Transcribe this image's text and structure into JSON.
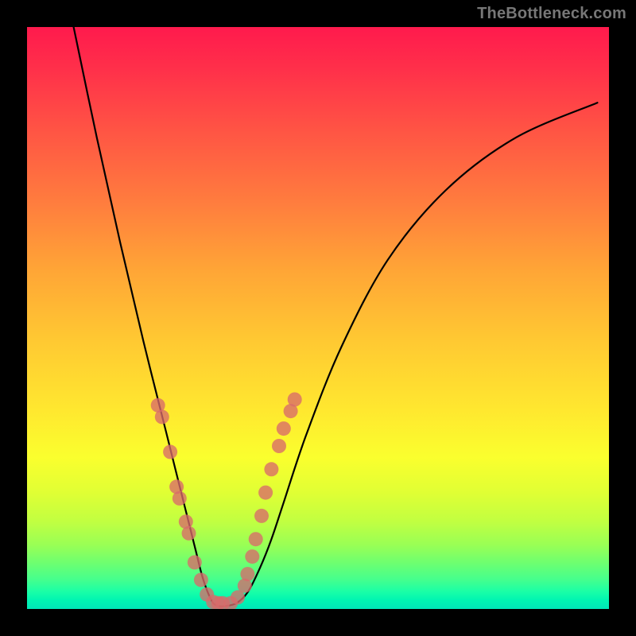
{
  "watermark_text": "TheBottleneck.com",
  "chart_data": {
    "type": "line",
    "title": "",
    "xlabel": "",
    "ylabel": "",
    "xlim": [
      0,
      100
    ],
    "ylim": [
      0,
      100
    ],
    "grid": false,
    "legend": false,
    "annotations": [
      "TheBottleneck.com"
    ],
    "background_gradient": {
      "direction": "vertical",
      "stops": [
        {
          "pos": 0.0,
          "color": "#ff1a4d"
        },
        {
          "pos": 0.18,
          "color": "#ff5544"
        },
        {
          "pos": 0.42,
          "color": "#ffa636"
        },
        {
          "pos": 0.66,
          "color": "#ffe82f"
        },
        {
          "pos": 0.85,
          "color": "#c1ff41"
        },
        {
          "pos": 1.0,
          "color": "#00e6b8"
        }
      ]
    },
    "series": [
      {
        "name": "bottleneck-curve",
        "type": "line",
        "color": "#000000",
        "x": [
          8,
          12,
          16,
          20,
          24,
          26,
          28,
          29,
          30,
          31,
          32,
          33,
          34,
          36,
          38,
          40,
          42,
          44,
          48,
          54,
          62,
          72,
          84,
          98
        ],
        "y": [
          100,
          81,
          63,
          46,
          30,
          22,
          14,
          10,
          6,
          3,
          1,
          0.5,
          0.5,
          1,
          3,
          7,
          12,
          18,
          30,
          45,
          60,
          72,
          81,
          87
        ]
      },
      {
        "name": "markers-left-branch",
        "type": "scatter",
        "color": "#d86a6a",
        "x": [
          22.5,
          23.2,
          24.6,
          25.7,
          26.2,
          27.3,
          27.8,
          28.8,
          29.9,
          30.9,
          32.0,
          32.9,
          33.6
        ],
        "y": [
          35,
          33,
          27,
          21,
          19,
          15,
          13,
          8,
          5,
          2.5,
          1.2,
          1,
          1
        ]
      },
      {
        "name": "markers-right-branch",
        "type": "scatter",
        "color": "#d86a6a",
        "x": [
          35.0,
          36.2,
          37.4,
          37.9,
          38.7,
          39.3,
          40.3,
          41.0,
          42.0,
          43.3,
          44.1,
          45.3,
          46.0
        ],
        "y": [
          1,
          2,
          4,
          6,
          9,
          12,
          16,
          20,
          24,
          28,
          31,
          34,
          36
        ]
      }
    ]
  }
}
